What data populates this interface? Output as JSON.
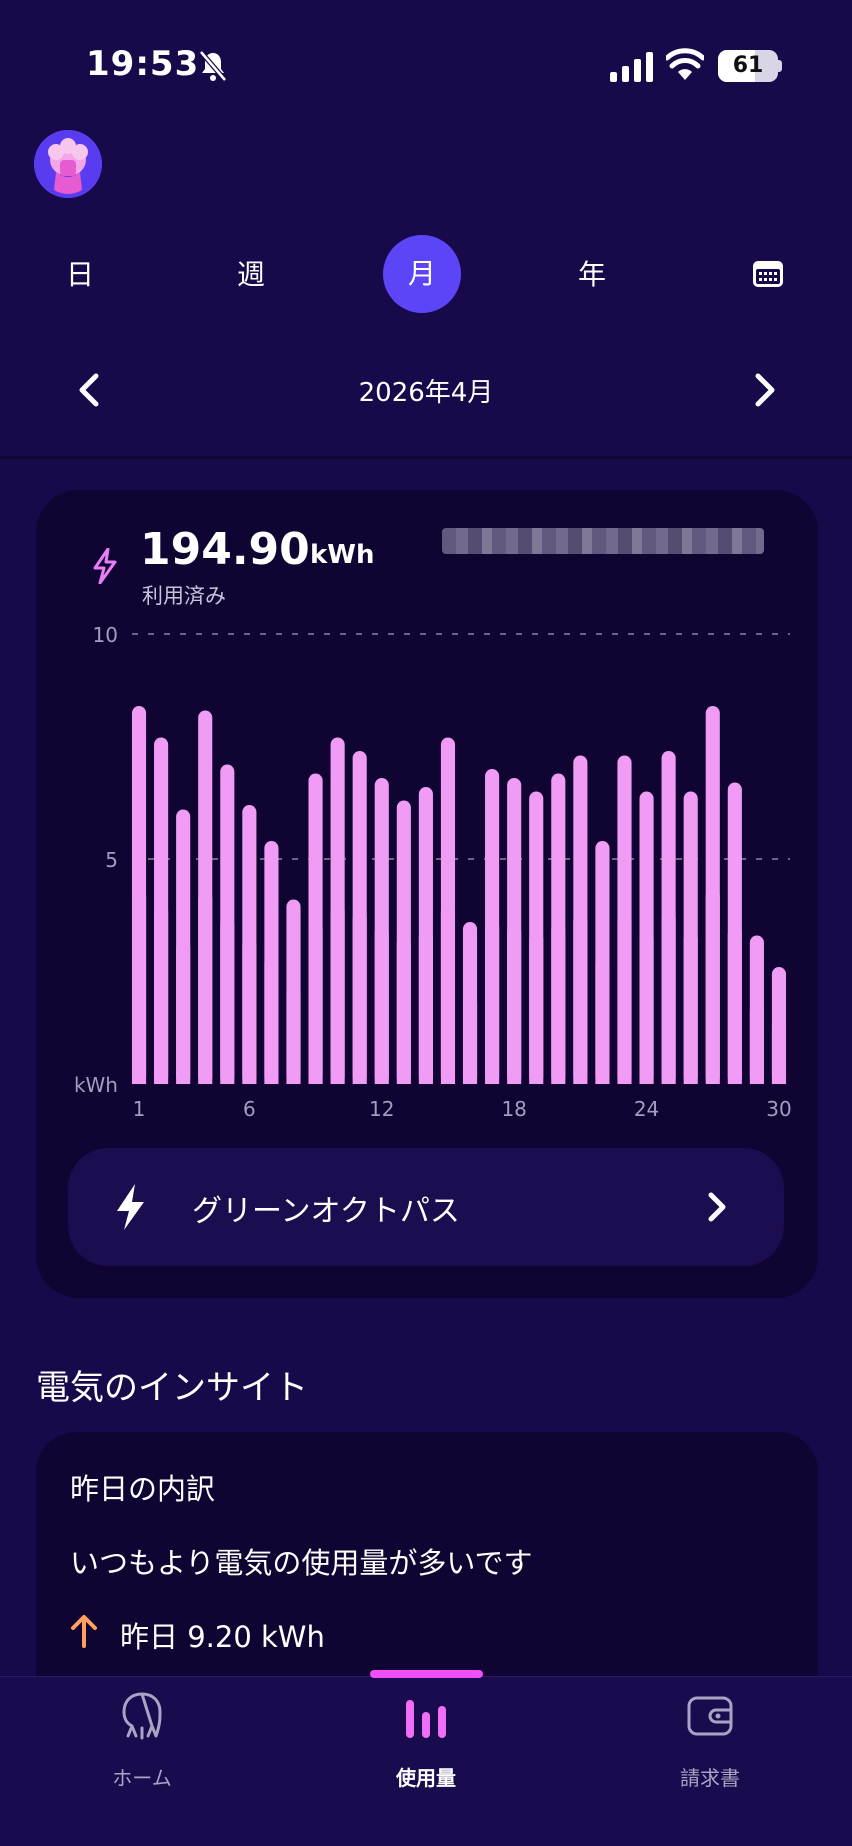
{
  "status_bar": {
    "time": "19:53",
    "battery": "61",
    "battery_level": 0.61
  },
  "tabs": {
    "day": "日",
    "week": "週",
    "month": "月",
    "year": "年",
    "selected": "month"
  },
  "period": {
    "label": "2026年4月"
  },
  "usage": {
    "value": "194.90",
    "unit": "kWh",
    "caption": "利用済み"
  },
  "tariff": {
    "name": "グリーンオクトパス"
  },
  "insights": {
    "title": "電気のインサイト",
    "card_heading": "昨日の内訳",
    "message": "いつもより電気の使用量が多いです",
    "yesterday": "昨日 9.20 kWh"
  },
  "nav": {
    "home": "ホーム",
    "usage": "使用量",
    "bills": "請求書",
    "selected": "usage"
  },
  "colors": {
    "background": "#180a4a",
    "card": "#100432",
    "accent": "#5b45f6",
    "bar": "#f09cf4",
    "nav_indicator": "#f050f8",
    "up_arrow": "#ffa060"
  },
  "chart_data": {
    "type": "bar",
    "x": [
      1,
      2,
      3,
      4,
      5,
      6,
      7,
      8,
      9,
      10,
      11,
      12,
      13,
      14,
      15,
      16,
      17,
      18,
      19,
      20,
      21,
      22,
      23,
      24,
      25,
      26,
      27,
      28,
      29,
      30
    ],
    "values": [
      8.4,
      7.7,
      6.1,
      8.3,
      7.1,
      6.2,
      5.4,
      4.1,
      6.9,
      7.7,
      7.4,
      6.8,
      6.3,
      6.6,
      7.7,
      3.6,
      7.0,
      6.8,
      6.5,
      6.9,
      7.3,
      5.4,
      7.3,
      6.5,
      7.4,
      6.5,
      8.4,
      6.7,
      3.3,
      2.6
    ],
    "xticks": [
      "1",
      "6",
      "12",
      "18",
      "24",
      "30"
    ],
    "xtick_values": [
      1,
      6,
      12,
      18,
      24,
      30
    ],
    "yticks": [
      "10",
      "5",
      "kWh"
    ],
    "ytick_values": [
      10,
      5,
      0
    ],
    "ylim": [
      0,
      10
    ],
    "ylabel": "kWh",
    "grid": "dashed horizontal at 5 and 10"
  }
}
